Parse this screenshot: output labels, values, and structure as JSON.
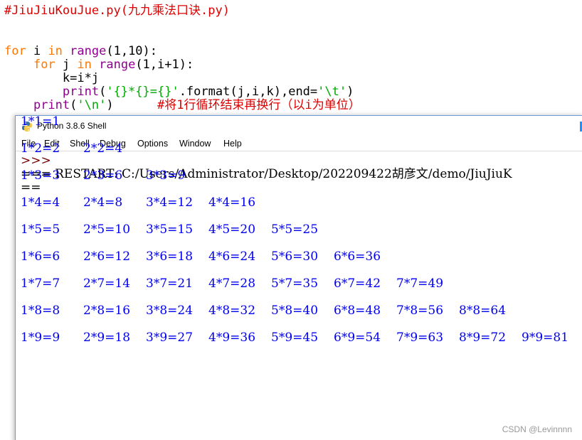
{
  "editor": {
    "lines": [
      {
        "parts": [
          {
            "cls": "comment",
            "text": "#JiuJiuKouJue.py(九九乘法口诀.py)"
          }
        ]
      },
      {
        "parts": []
      },
      {
        "parts": []
      },
      {
        "parts": [
          {
            "cls": "kw",
            "text": "for"
          },
          {
            "cls": "",
            "text": " i "
          },
          {
            "cls": "kw",
            "text": "in"
          },
          {
            "cls": "",
            "text": " "
          },
          {
            "cls": "bi",
            "text": "range"
          },
          {
            "cls": "",
            "text": "(1,10):"
          }
        ]
      },
      {
        "parts": [
          {
            "cls": "",
            "text": "    "
          },
          {
            "cls": "kw",
            "text": "for"
          },
          {
            "cls": "",
            "text": " j "
          },
          {
            "cls": "kw",
            "text": "in"
          },
          {
            "cls": "",
            "text": " "
          },
          {
            "cls": "bi",
            "text": "range"
          },
          {
            "cls": "",
            "text": "(1,i+1):"
          }
        ]
      },
      {
        "parts": [
          {
            "cls": "",
            "text": "        k=i*j"
          }
        ]
      },
      {
        "parts": [
          {
            "cls": "",
            "text": "        "
          },
          {
            "cls": "bi",
            "text": "print"
          },
          {
            "cls": "",
            "text": "("
          },
          {
            "cls": "str",
            "text": "'{}*{}={}'"
          },
          {
            "cls": "",
            "text": ".format(j,i,k),end="
          },
          {
            "cls": "str",
            "text": "'\\t'"
          },
          {
            "cls": "",
            "text": ")"
          }
        ]
      },
      {
        "parts": [
          {
            "cls": "",
            "text": "    "
          },
          {
            "cls": "bi",
            "text": "print"
          },
          {
            "cls": "",
            "text": "("
          },
          {
            "cls": "str",
            "text": "'\\n'"
          },
          {
            "cls": "",
            "text": ")      "
          },
          {
            "cls": "comment",
            "text": "#将1行循环结束再换行（以i为单位）"
          }
        ]
      }
    ]
  },
  "shell": {
    "title": "Python 3.8.6 Shell",
    "menu": [
      "File",
      "Edit",
      "Shell",
      "Debug",
      "Options",
      "Window",
      "Help"
    ],
    "prompt": ">>>",
    "restart_line": "=== RESTART: C:/Users/Administrator/Desktop/202209422胡彦文/demo/JiuJiuK",
    "restart_cont": "==",
    "table": [
      [
        "1*1=1"
      ],
      [
        "1*2=2",
        "2*2=4"
      ],
      [
        "1*3=3",
        "2*3=6",
        "3*3=9"
      ],
      [
        "1*4=4",
        "2*4=8",
        "3*4=12",
        "4*4=16"
      ],
      [
        "1*5=5",
        "2*5=10",
        "3*5=15",
        "4*5=20",
        "5*5=25"
      ],
      [
        "1*6=6",
        "2*6=12",
        "3*6=18",
        "4*6=24",
        "5*6=30",
        "6*6=36"
      ],
      [
        "1*7=7",
        "2*7=14",
        "3*7=21",
        "4*7=28",
        "5*7=35",
        "6*7=42",
        "7*7=49"
      ],
      [
        "1*8=8",
        "2*8=16",
        "3*8=24",
        "4*8=32",
        "5*8=40",
        "6*8=48",
        "7*8=56",
        "8*8=64"
      ],
      [
        "1*9=9",
        "2*9=18",
        "3*9=27",
        "4*9=36",
        "5*9=45",
        "6*9=54",
        "7*9=63",
        "8*9=72",
        "9*9=81"
      ]
    ]
  },
  "watermark": "CSDN @Levinnnn",
  "colors": {
    "output": "#0000ee",
    "keyword": "#ff7700",
    "builtin": "#900090",
    "string": "#00aa00",
    "comment": "#dd0000"
  }
}
